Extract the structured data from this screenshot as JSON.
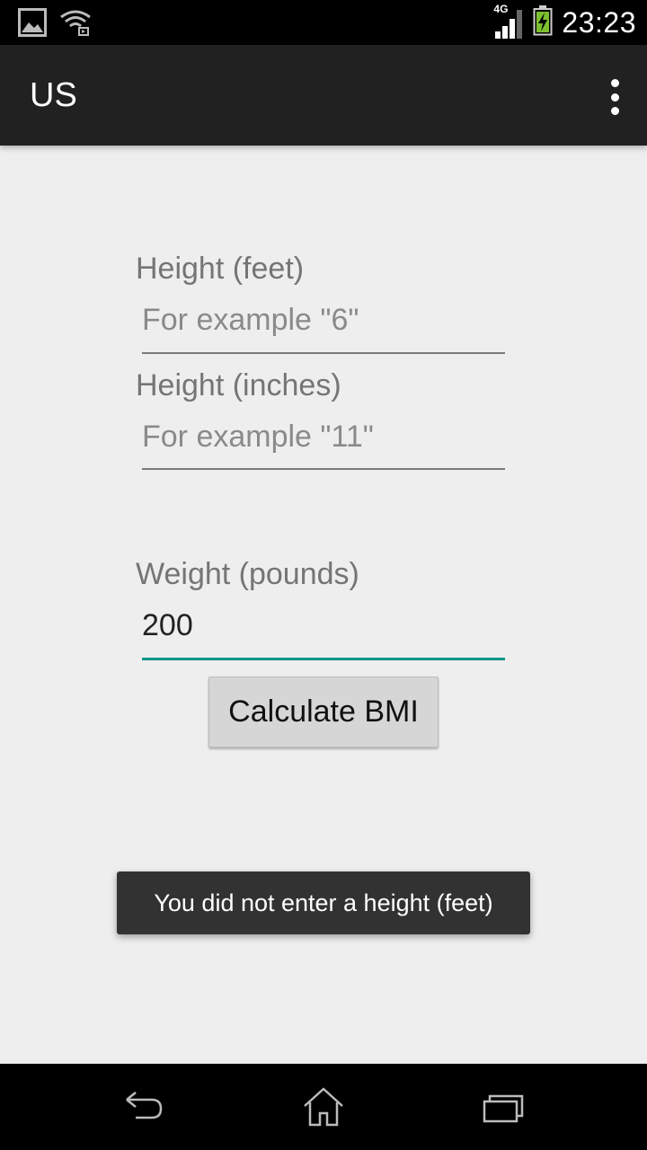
{
  "status_bar": {
    "time": "23:23",
    "network_type": "4G",
    "icons": [
      "image-notification-icon",
      "wifi-cast-icon",
      "signal-icon",
      "battery-charging-icon"
    ]
  },
  "action_bar": {
    "title": "US",
    "overflow_icon": "overflow-menu-icon"
  },
  "form": {
    "height_feet": {
      "label": "Height (feet)",
      "placeholder": "For example \"6\"",
      "value": ""
    },
    "height_inches": {
      "label": "Height (inches)",
      "placeholder": "For example \"11\"",
      "value": ""
    },
    "weight_pounds": {
      "label": "Weight (pounds)",
      "placeholder": "",
      "value": "200"
    },
    "calculate_button_label": "Calculate BMI"
  },
  "toast": {
    "message": "You did not enter a height (feet)"
  },
  "nav_bar": {
    "icons": [
      "back-icon",
      "home-icon",
      "recent-apps-icon"
    ]
  },
  "colors": {
    "accent": "#009688",
    "action_bar": "#212121",
    "background": "#eeeeee",
    "toast": "#323232"
  }
}
